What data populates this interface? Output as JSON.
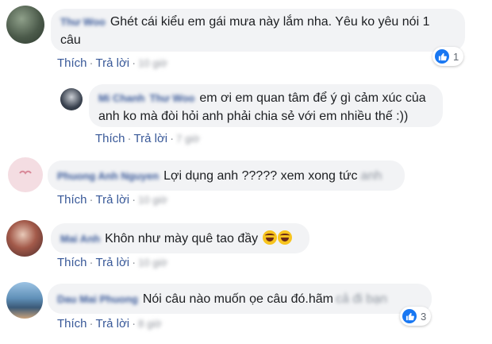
{
  "comments": [
    {
      "author": "Thư Woo",
      "text_line1": "Ghét cái kiểu em gái mưa này lắm nha. Yêu ko yêu nói 1",
      "text_line2": "câu",
      "like_label": "Thích",
      "reply_label": "Trả lời",
      "time": "10 giờ",
      "reaction_icon": "like-icon",
      "reaction_count": "1"
    },
    {
      "author": "Mi Chanh",
      "tagged": "Thư Woo",
      "text_line1": "em ơi em quan tâm để ý gì cảm xúc của",
      "text_line2": "anh ko mà đòi hỏi anh phải chia sẻ với em nhiều thế :))",
      "like_label": "Thích",
      "reply_label": "Trả lời",
      "time": "7 giờ"
    },
    {
      "author": "Phuong Anh Nguyen",
      "text": "Lợi dụng anh ????? xem xong tức",
      "hidden_tail": "anh",
      "like_label": "Thích",
      "reply_label": "Trả lời",
      "time": "10 giờ"
    },
    {
      "author": "Mai Anh",
      "text": "Khôn như mày quê tao đầy",
      "emojis": [
        "rofl-emoji",
        "rofl-emoji"
      ],
      "like_label": "Thích",
      "reply_label": "Trả lời",
      "time": "10 giờ"
    },
    {
      "author": "Dau Mai Phuong",
      "text": "Nói câu nào muốn ọe câu đó.hãm",
      "hidden_tail": "cả đi bạn",
      "like_label": "Thích",
      "reply_label": "Trả lời",
      "time": "8 giờ",
      "reaction_icon": "like-icon",
      "reaction_count": "3"
    }
  ],
  "colors": {
    "bubble": "#f2f3f5",
    "link": "#385898",
    "like_blue": "#1877f2"
  }
}
